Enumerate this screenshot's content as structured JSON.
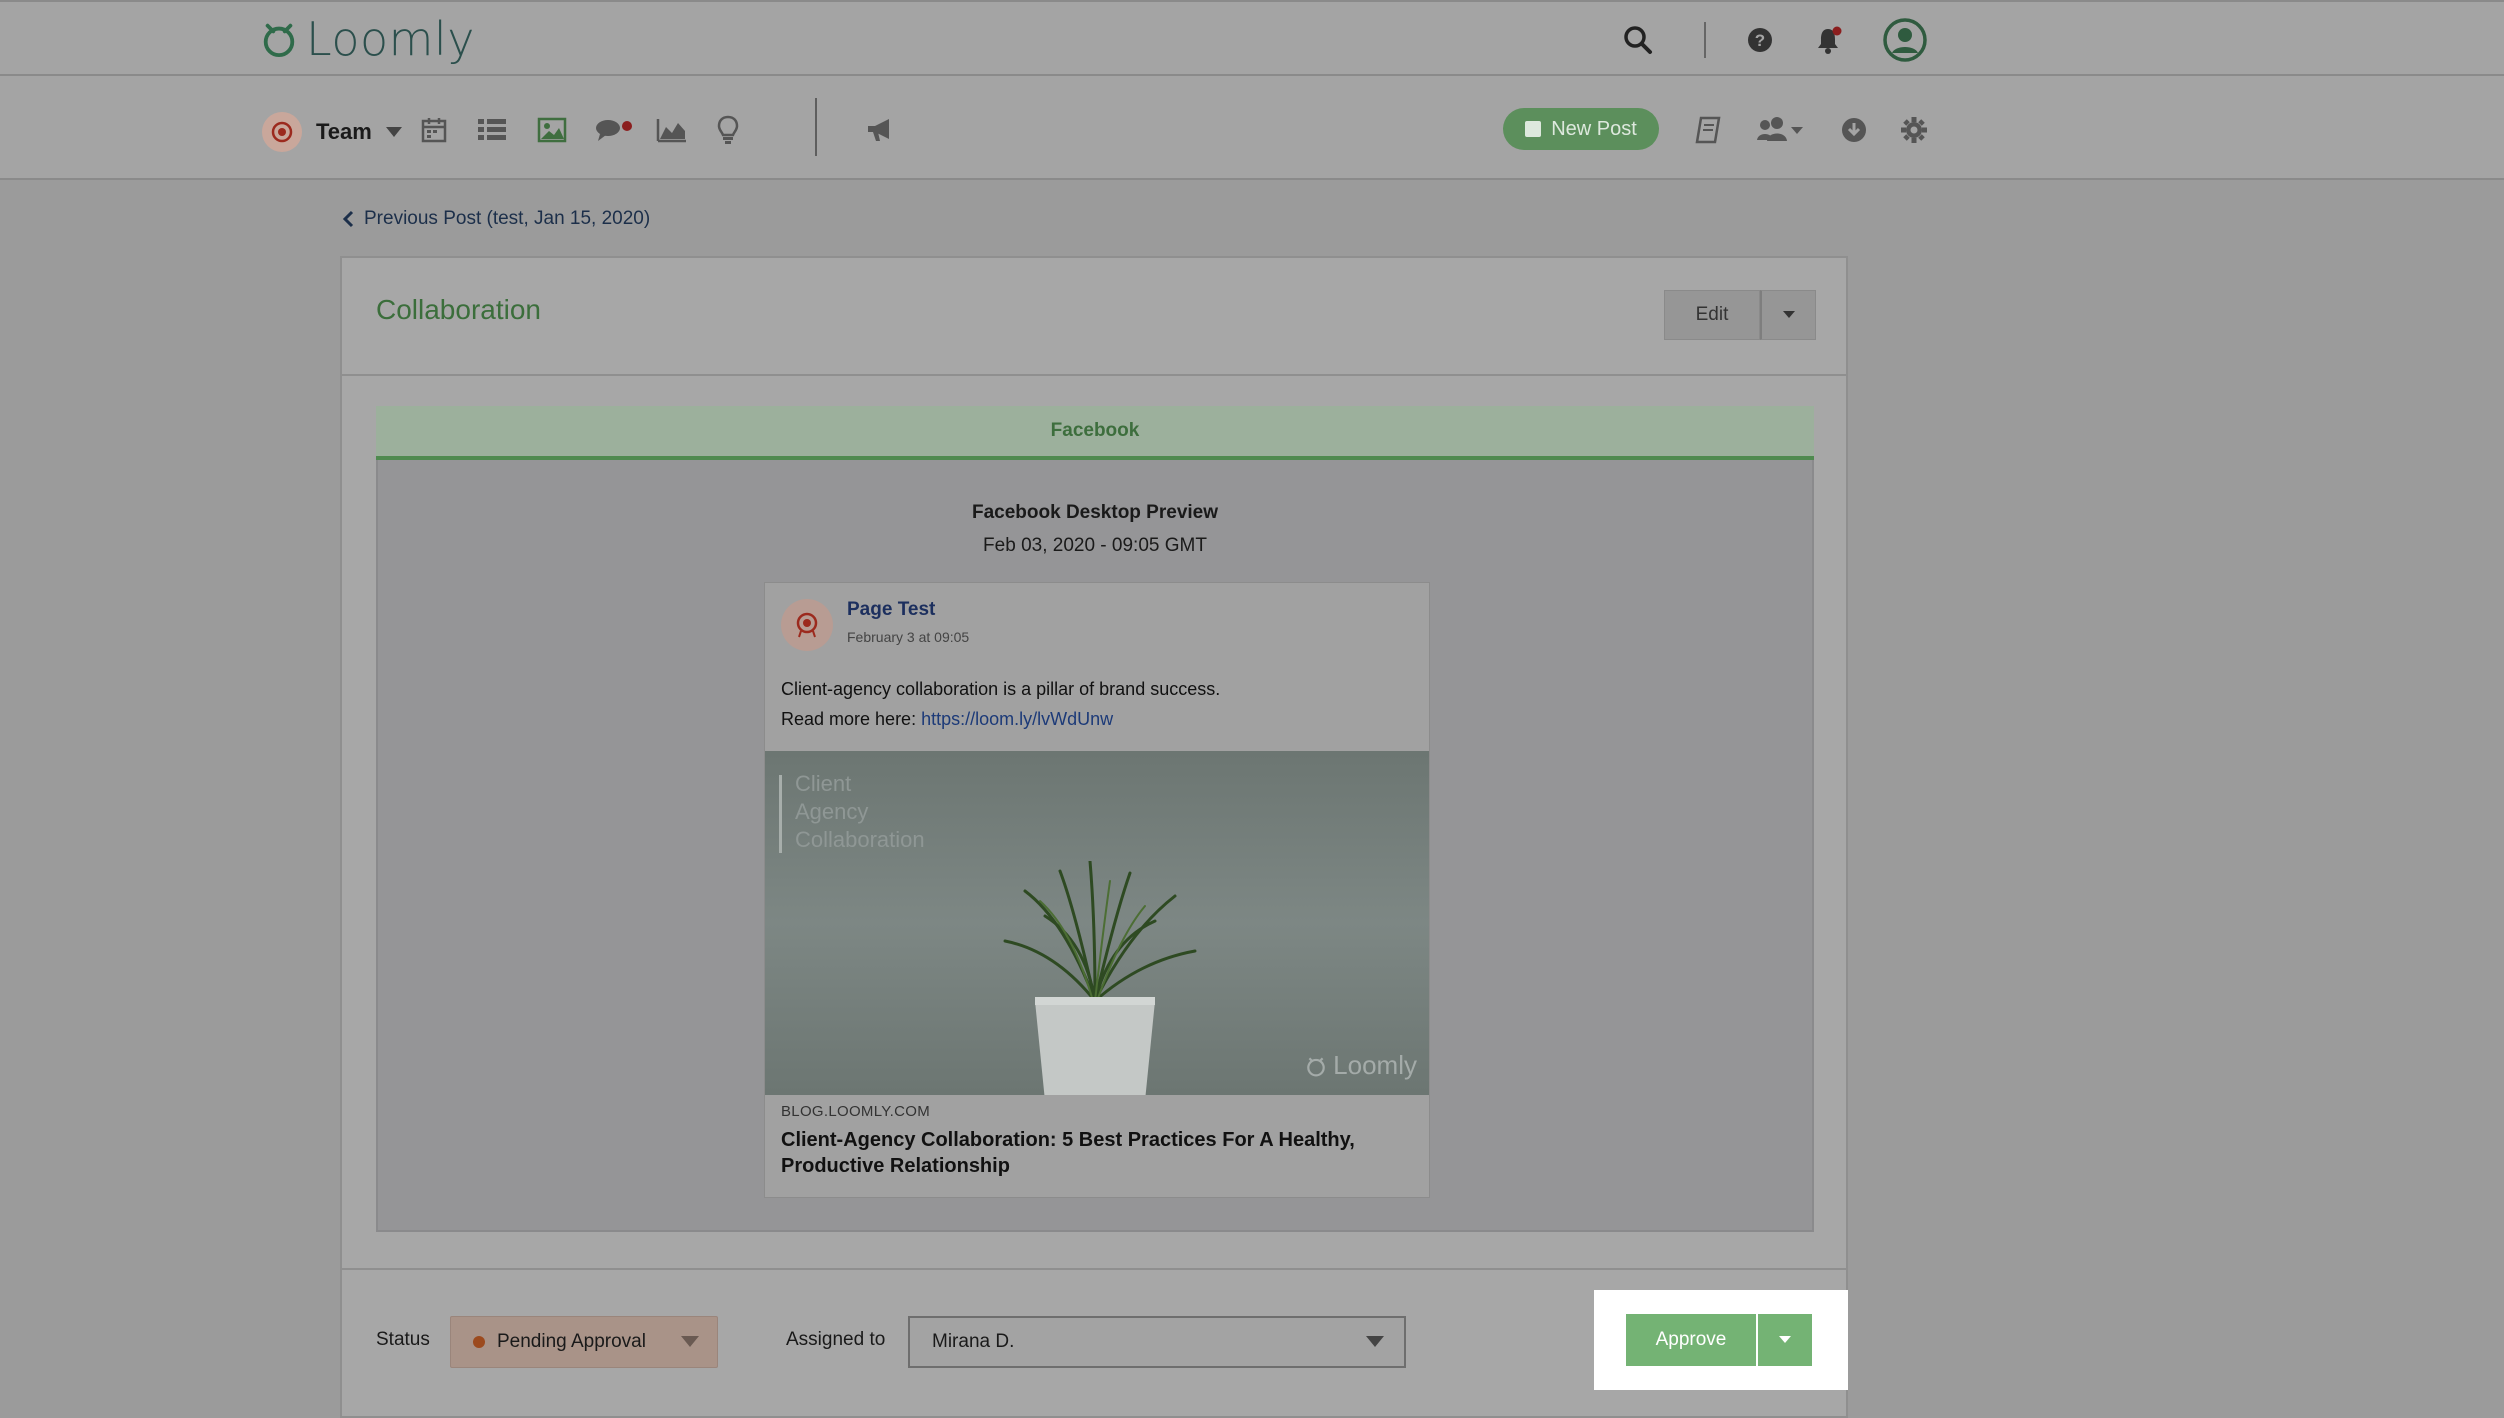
{
  "app": {
    "name": "Loomly"
  },
  "colors": {
    "brand_green": "#3b6e3b",
    "approve_green": "#74b374",
    "pending": "#9c4a1e"
  },
  "topbar": {
    "icons": [
      "search-icon",
      "help-icon",
      "notification-bell-icon",
      "user-avatar-icon"
    ]
  },
  "subnav": {
    "team_label": "Team",
    "icons": [
      "calendar-icon",
      "list-icon",
      "image-library-icon",
      "conversations-icon",
      "analytics-icon",
      "ideas-icon",
      "advocacy-icon"
    ],
    "new_post_label": "New Post",
    "right_icons": [
      "notes-icon",
      "users-icon",
      "download-icon",
      "settings-icon"
    ]
  },
  "navigation": {
    "previous_post_label": "Previous Post (test, Jan 15, 2020)"
  },
  "post": {
    "title": "Collaboration",
    "edit_label": "Edit",
    "tab_label": "Facebook",
    "preview_title": "Facebook Desktop Preview",
    "preview_date": "Feb 03, 2020 - 09:05 GMT",
    "card": {
      "page_name": "Page Test",
      "timestamp": "February 3 at 09:05",
      "text_line1": "Client-agency collaboration is a pillar of brand success.",
      "text_line2_prefix": "Read more here: ",
      "link": "https://loom.ly/lvWdUnw",
      "image_lines": [
        "Client",
        "Agency",
        "Collaboration"
      ],
      "image_brand": "Loomly",
      "domain": "BLOG.LOOMLY.COM",
      "headline": "Client-Agency Collaboration: 5 Best Practices For A Healthy, Productive Relationship"
    }
  },
  "footer": {
    "status_label": "Status",
    "status_value": "Pending Approval",
    "assigned_label": "Assigned to",
    "assigned_value": "Mirana D.",
    "approve_label": "Approve"
  }
}
